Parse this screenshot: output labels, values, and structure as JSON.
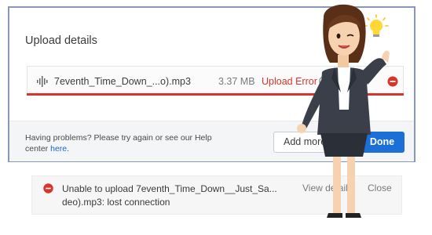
{
  "dialog": {
    "title": "Upload details",
    "file": {
      "name": "7eventh_Time_Down_...o).mp3",
      "size": "3.37 MB",
      "status": "Upload Error",
      "icon": "waveform-icon"
    },
    "footer": {
      "help_text": "Having problems? Please try again or see our Help center",
      "help_link": "here",
      "help_suffix": ".",
      "add_more_label": "Add more",
      "done_label": "Done"
    }
  },
  "toast": {
    "message": "Unable to upload 7eventh_Time_Down__Just_Sa... deo).mp3: lost connection",
    "view_details_label": "View details",
    "close_label": "Close",
    "icon": "error-circle-icon"
  },
  "colors": {
    "error": "#d9342b",
    "primary": "#1b6fd6",
    "dialog_border": "#8a97b8"
  }
}
